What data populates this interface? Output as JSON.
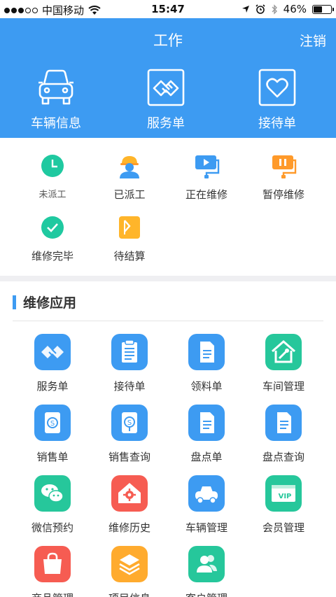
{
  "status_bar": {
    "carrier": "中国移动",
    "time": "15:47",
    "battery": "46%"
  },
  "header": {
    "title": "工作",
    "logout": "注销",
    "items": [
      {
        "label": "车辆信息",
        "icon": "car-icon"
      },
      {
        "label": "服务单",
        "icon": "handshake-icon"
      },
      {
        "label": "接待单",
        "icon": "heart-icon"
      }
    ]
  },
  "status": {
    "items": [
      {
        "label": "未派工",
        "icon": "clock-icon",
        "color": "#1fc9a0"
      },
      {
        "label": "已派工",
        "icon": "worker-icon",
        "color": "#3d9bf2"
      },
      {
        "label": "正在维修",
        "icon": "repairing-icon",
        "color": "#3d9bf2"
      },
      {
        "label": "暂停维修",
        "icon": "paused-icon",
        "color": "#ff9a2a"
      },
      {
        "label": "维修完毕",
        "icon": "check-icon",
        "color": "#1fc9a0"
      },
      {
        "label": "待结算",
        "icon": "wallet-icon",
        "color": "#ffb52a"
      }
    ]
  },
  "apps_section": {
    "title": "维修应用",
    "items": [
      {
        "label": "服务单",
        "icon": "handshake-icon",
        "color": "#3d9bf2"
      },
      {
        "label": "接待单",
        "icon": "clipboard-icon",
        "color": "#3d9bf2"
      },
      {
        "label": "领料单",
        "icon": "document-icon",
        "color": "#3d9bf2"
      },
      {
        "label": "车间管理",
        "icon": "house-icon",
        "color": "#26c79b"
      },
      {
        "label": "销售单",
        "icon": "sales-icon",
        "color": "#3d9bf2"
      },
      {
        "label": "销售查询",
        "icon": "sales-search-icon",
        "color": "#3d9bf2"
      },
      {
        "label": "盘点单",
        "icon": "inventory-icon",
        "color": "#3d9bf2"
      },
      {
        "label": "盘点查询",
        "icon": "inventory-search-icon",
        "color": "#3d9bf2"
      },
      {
        "label": "微信预约",
        "icon": "wechat-icon",
        "color": "#26c79b"
      },
      {
        "label": "维修历史",
        "icon": "history-icon",
        "color": "#f65c52"
      },
      {
        "label": "车辆管理",
        "icon": "car-icon",
        "color": "#3d9bf2"
      },
      {
        "label": "会员管理",
        "icon": "vip-icon",
        "color": "#26c79b"
      },
      {
        "label": "商品管理",
        "icon": "bag-icon",
        "color": "#f65c52"
      },
      {
        "label": "项目信息",
        "icon": "layers-icon",
        "color": "#ffab2e"
      },
      {
        "label": "客户管理",
        "icon": "users-icon",
        "color": "#26c79b"
      }
    ]
  }
}
